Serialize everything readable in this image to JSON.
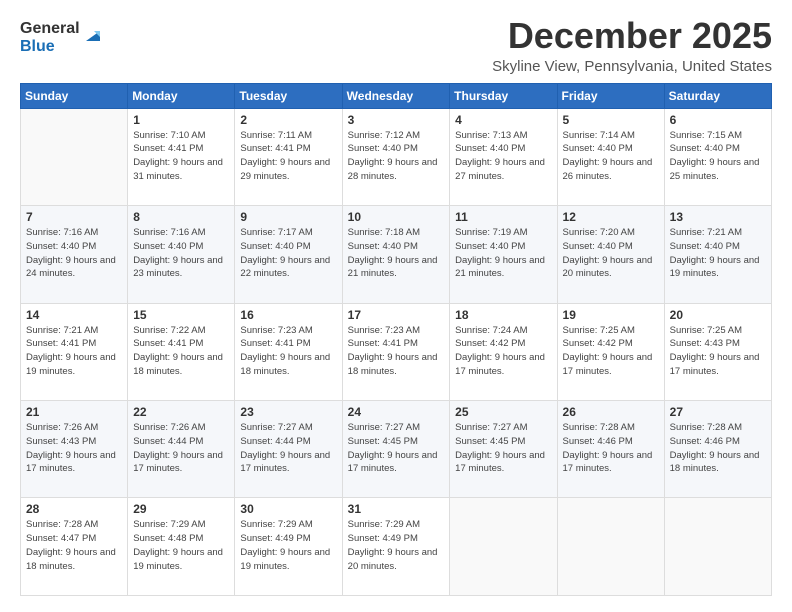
{
  "logo": {
    "line1": "General",
    "line2": "Blue"
  },
  "title": "December 2025",
  "location": "Skyline View, Pennsylvania, United States",
  "days_of_week": [
    "Sunday",
    "Monday",
    "Tuesday",
    "Wednesday",
    "Thursday",
    "Friday",
    "Saturday"
  ],
  "weeks": [
    [
      {
        "day": "",
        "sunrise": "",
        "sunset": "",
        "daylight": ""
      },
      {
        "day": "1",
        "sunrise": "Sunrise: 7:10 AM",
        "sunset": "Sunset: 4:41 PM",
        "daylight": "Daylight: 9 hours and 31 minutes."
      },
      {
        "day": "2",
        "sunrise": "Sunrise: 7:11 AM",
        "sunset": "Sunset: 4:41 PM",
        "daylight": "Daylight: 9 hours and 29 minutes."
      },
      {
        "day": "3",
        "sunrise": "Sunrise: 7:12 AM",
        "sunset": "Sunset: 4:40 PM",
        "daylight": "Daylight: 9 hours and 28 minutes."
      },
      {
        "day": "4",
        "sunrise": "Sunrise: 7:13 AM",
        "sunset": "Sunset: 4:40 PM",
        "daylight": "Daylight: 9 hours and 27 minutes."
      },
      {
        "day": "5",
        "sunrise": "Sunrise: 7:14 AM",
        "sunset": "Sunset: 4:40 PM",
        "daylight": "Daylight: 9 hours and 26 minutes."
      },
      {
        "day": "6",
        "sunrise": "Sunrise: 7:15 AM",
        "sunset": "Sunset: 4:40 PM",
        "daylight": "Daylight: 9 hours and 25 minutes."
      }
    ],
    [
      {
        "day": "7",
        "sunrise": "Sunrise: 7:16 AM",
        "sunset": "Sunset: 4:40 PM",
        "daylight": "Daylight: 9 hours and 24 minutes."
      },
      {
        "day": "8",
        "sunrise": "Sunrise: 7:16 AM",
        "sunset": "Sunset: 4:40 PM",
        "daylight": "Daylight: 9 hours and 23 minutes."
      },
      {
        "day": "9",
        "sunrise": "Sunrise: 7:17 AM",
        "sunset": "Sunset: 4:40 PM",
        "daylight": "Daylight: 9 hours and 22 minutes."
      },
      {
        "day": "10",
        "sunrise": "Sunrise: 7:18 AM",
        "sunset": "Sunset: 4:40 PM",
        "daylight": "Daylight: 9 hours and 21 minutes."
      },
      {
        "day": "11",
        "sunrise": "Sunrise: 7:19 AM",
        "sunset": "Sunset: 4:40 PM",
        "daylight": "Daylight: 9 hours and 21 minutes."
      },
      {
        "day": "12",
        "sunrise": "Sunrise: 7:20 AM",
        "sunset": "Sunset: 4:40 PM",
        "daylight": "Daylight: 9 hours and 20 minutes."
      },
      {
        "day": "13",
        "sunrise": "Sunrise: 7:21 AM",
        "sunset": "Sunset: 4:40 PM",
        "daylight": "Daylight: 9 hours and 19 minutes."
      }
    ],
    [
      {
        "day": "14",
        "sunrise": "Sunrise: 7:21 AM",
        "sunset": "Sunset: 4:41 PM",
        "daylight": "Daylight: 9 hours and 19 minutes."
      },
      {
        "day": "15",
        "sunrise": "Sunrise: 7:22 AM",
        "sunset": "Sunset: 4:41 PM",
        "daylight": "Daylight: 9 hours and 18 minutes."
      },
      {
        "day": "16",
        "sunrise": "Sunrise: 7:23 AM",
        "sunset": "Sunset: 4:41 PM",
        "daylight": "Daylight: 9 hours and 18 minutes."
      },
      {
        "day": "17",
        "sunrise": "Sunrise: 7:23 AM",
        "sunset": "Sunset: 4:41 PM",
        "daylight": "Daylight: 9 hours and 18 minutes."
      },
      {
        "day": "18",
        "sunrise": "Sunrise: 7:24 AM",
        "sunset": "Sunset: 4:42 PM",
        "daylight": "Daylight: 9 hours and 17 minutes."
      },
      {
        "day": "19",
        "sunrise": "Sunrise: 7:25 AM",
        "sunset": "Sunset: 4:42 PM",
        "daylight": "Daylight: 9 hours and 17 minutes."
      },
      {
        "day": "20",
        "sunrise": "Sunrise: 7:25 AM",
        "sunset": "Sunset: 4:43 PM",
        "daylight": "Daylight: 9 hours and 17 minutes."
      }
    ],
    [
      {
        "day": "21",
        "sunrise": "Sunrise: 7:26 AM",
        "sunset": "Sunset: 4:43 PM",
        "daylight": "Daylight: 9 hours and 17 minutes."
      },
      {
        "day": "22",
        "sunrise": "Sunrise: 7:26 AM",
        "sunset": "Sunset: 4:44 PM",
        "daylight": "Daylight: 9 hours and 17 minutes."
      },
      {
        "day": "23",
        "sunrise": "Sunrise: 7:27 AM",
        "sunset": "Sunset: 4:44 PM",
        "daylight": "Daylight: 9 hours and 17 minutes."
      },
      {
        "day": "24",
        "sunrise": "Sunrise: 7:27 AM",
        "sunset": "Sunset: 4:45 PM",
        "daylight": "Daylight: 9 hours and 17 minutes."
      },
      {
        "day": "25",
        "sunrise": "Sunrise: 7:27 AM",
        "sunset": "Sunset: 4:45 PM",
        "daylight": "Daylight: 9 hours and 17 minutes."
      },
      {
        "day": "26",
        "sunrise": "Sunrise: 7:28 AM",
        "sunset": "Sunset: 4:46 PM",
        "daylight": "Daylight: 9 hours and 17 minutes."
      },
      {
        "day": "27",
        "sunrise": "Sunrise: 7:28 AM",
        "sunset": "Sunset: 4:46 PM",
        "daylight": "Daylight: 9 hours and 18 minutes."
      }
    ],
    [
      {
        "day": "28",
        "sunrise": "Sunrise: 7:28 AM",
        "sunset": "Sunset: 4:47 PM",
        "daylight": "Daylight: 9 hours and 18 minutes."
      },
      {
        "day": "29",
        "sunrise": "Sunrise: 7:29 AM",
        "sunset": "Sunset: 4:48 PM",
        "daylight": "Daylight: 9 hours and 19 minutes."
      },
      {
        "day": "30",
        "sunrise": "Sunrise: 7:29 AM",
        "sunset": "Sunset: 4:49 PM",
        "daylight": "Daylight: 9 hours and 19 minutes."
      },
      {
        "day": "31",
        "sunrise": "Sunrise: 7:29 AM",
        "sunset": "Sunset: 4:49 PM",
        "daylight": "Daylight: 9 hours and 20 minutes."
      },
      {
        "day": "",
        "sunrise": "",
        "sunset": "",
        "daylight": ""
      },
      {
        "day": "",
        "sunrise": "",
        "sunset": "",
        "daylight": ""
      },
      {
        "day": "",
        "sunrise": "",
        "sunset": "",
        "daylight": ""
      }
    ]
  ]
}
